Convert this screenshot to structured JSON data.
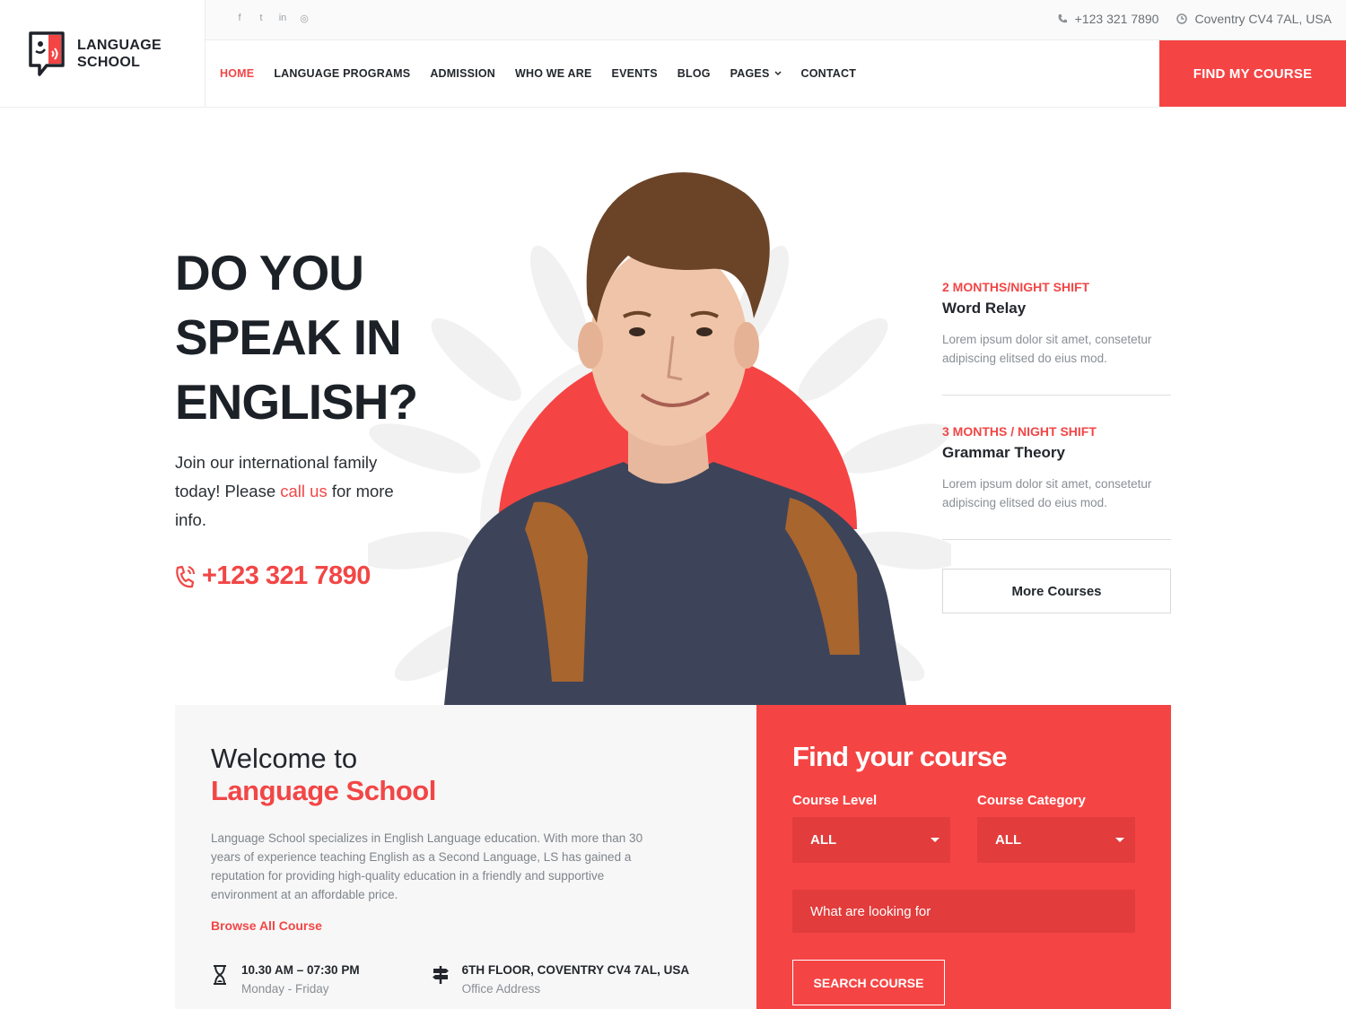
{
  "brand": {
    "logo_line1": "LANGUAGE",
    "logo_line2": "SCHOOL",
    "accent": "#f54444"
  },
  "topbar": {
    "socials": [
      "facebook-icon",
      "twitter-icon",
      "linkedin-icon",
      "instagram-icon"
    ],
    "social_glyphs": [
      "f",
      "t",
      "in",
      "◎"
    ],
    "phone": "+123 321 7890",
    "address": "Coventry CV4 7AL, USA"
  },
  "nav": {
    "items": [
      "HOME",
      "LANGUAGE PROGRAMS",
      "ADMISSION",
      "WHO WE ARE",
      "EVENTS",
      "BLOG",
      "PAGES",
      "CONTACT"
    ],
    "active": "HOME",
    "cta": "FIND MY COURSE"
  },
  "hero": {
    "title_line1": "DO YOU",
    "title_line2": "SPEAK IN",
    "title_line3": "ENGLISH?",
    "sub_before": "Join our international family today! Please ",
    "sub_link": "call us",
    "sub_after": " for more info.",
    "phone": "+123 321 7890"
  },
  "courses": [
    {
      "tag": "2 MONTHS/NIGHT SHIFT",
      "name": "Word Relay",
      "desc": "Lorem ipsum dolor sit amet, consetetur adipiscing elitsed do eius mod."
    },
    {
      "tag": "3 MONTHS / NIGHT SHIFT",
      "name": "Grammar Theory",
      "desc": "Lorem ipsum dolor sit amet, consetetur adipiscing elitsed do eius mod."
    }
  ],
  "more_courses": "More Courses",
  "welcome": {
    "pre": "Welcome to",
    "name": "Language School",
    "text": "Language School specializes in English Language education. With more than 30 years of experience teaching English as a Second Language, LS has gained a reputation for providing high-quality education in a friendly and supportive environment at an affordable price.",
    "browse": "Browse All Course",
    "hours_main": "10.30 AM – 07:30 PM",
    "hours_sub": "Monday - Friday",
    "address_main": "6TH FLOOR, COVENTRY CV4 7AL, USA",
    "address_sub": "Office Address"
  },
  "finder": {
    "title": "Find your course",
    "level_label": "Course Level",
    "level_value": "ALL",
    "category_label": "Course Category",
    "category_value": "ALL",
    "search_placeholder": "What are looking for",
    "search_button": "SEARCH COURSE"
  }
}
